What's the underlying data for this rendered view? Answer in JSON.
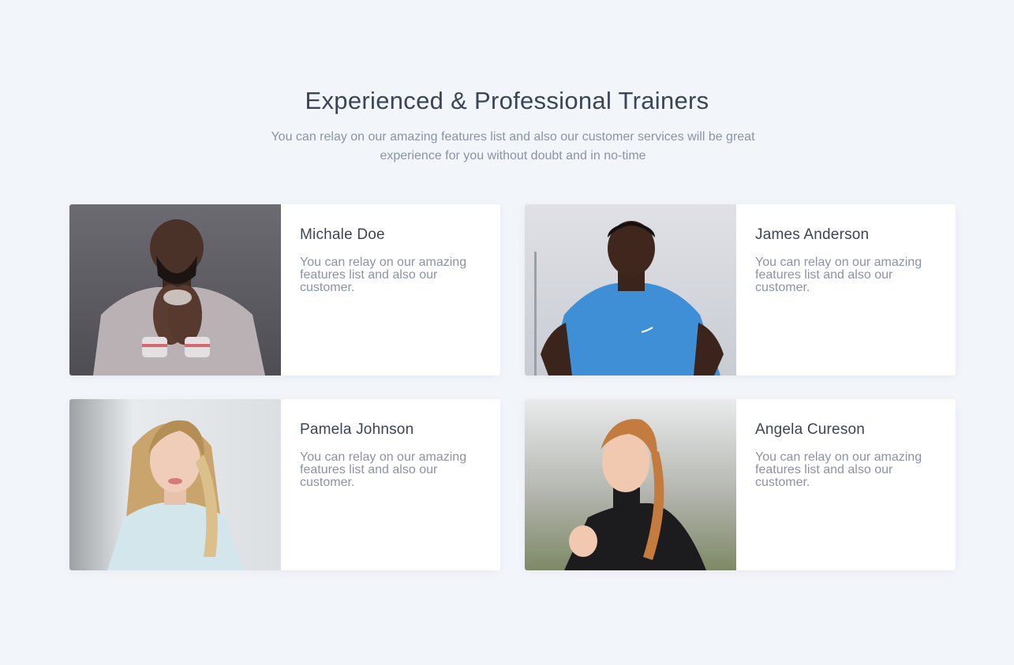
{
  "section": {
    "title": "Experienced & Professional Trainers",
    "subtitle": "You can relay on our amazing features list and also our customer services will be great experience for you without doubt and in no-time"
  },
  "trainers": [
    {
      "name": "Michale Doe",
      "description": "You can relay on our amazing features list and also our customer.",
      "photo_icon": "trainer-photo"
    },
    {
      "name": "James Anderson",
      "description": "You can relay on our amazing features list and also our customer.",
      "photo_icon": "trainer-photo"
    },
    {
      "name": "Pamela Johnson",
      "description": "You can relay on our amazing features list and also our customer.",
      "photo_icon": "trainer-photo"
    },
    {
      "name": "Angela Cureson",
      "description": "You can relay on our amazing features list and also our customer.",
      "photo_icon": "trainer-photo"
    }
  ],
  "colors": {
    "background": "#f2f5f9",
    "card": "#ffffff",
    "heading": "#3c4556",
    "muted": "#8a93a6"
  }
}
